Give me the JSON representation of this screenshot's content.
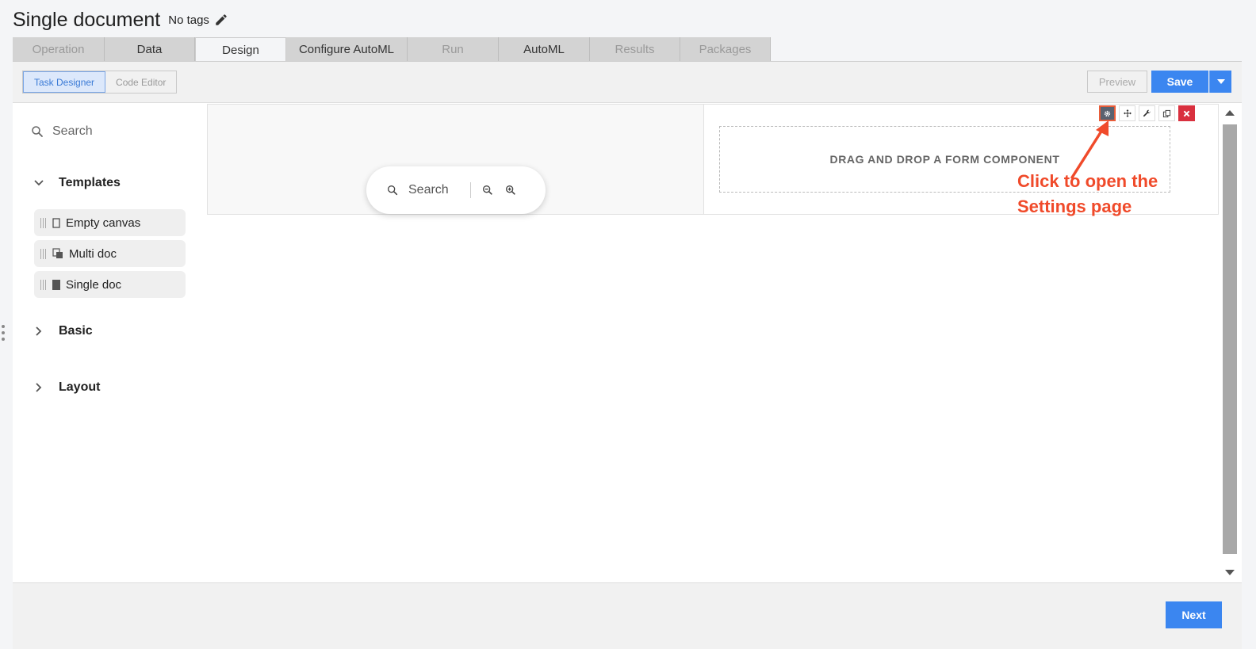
{
  "header": {
    "title": "Single document",
    "tags": "No tags"
  },
  "tabs": [
    {
      "label": "Operation",
      "state": "disabled"
    },
    {
      "label": "Data",
      "state": "normal"
    },
    {
      "label": "Design",
      "state": "active"
    },
    {
      "label": "Configure AutoML",
      "state": "normal"
    },
    {
      "label": "Run",
      "state": "disabled"
    },
    {
      "label": "AutoML",
      "state": "normal"
    },
    {
      "label": "Results",
      "state": "disabled"
    },
    {
      "label": "Packages",
      "state": "disabled"
    }
  ],
  "toolbar": {
    "task_designer": "Task Designer",
    "code_editor": "Code Editor",
    "preview": "Preview",
    "save": "Save"
  },
  "sidebar": {
    "search_placeholder": "Search",
    "templates_label": "Templates",
    "templates": [
      "Empty canvas",
      "Multi doc",
      "Single doc"
    ],
    "basic_label": "Basic",
    "layout_label": "Layout"
  },
  "canvas": {
    "search_placeholder": "Search",
    "dropzone_text": "DRAG AND DROP A FORM COMPONENT"
  },
  "annotation": {
    "line1": "Click to open the",
    "line2": "Settings page"
  },
  "footer": {
    "next": "Next"
  },
  "colors": {
    "accent": "#3b86f0",
    "annotation": "#f04a2a",
    "delete": "#d9303e"
  }
}
